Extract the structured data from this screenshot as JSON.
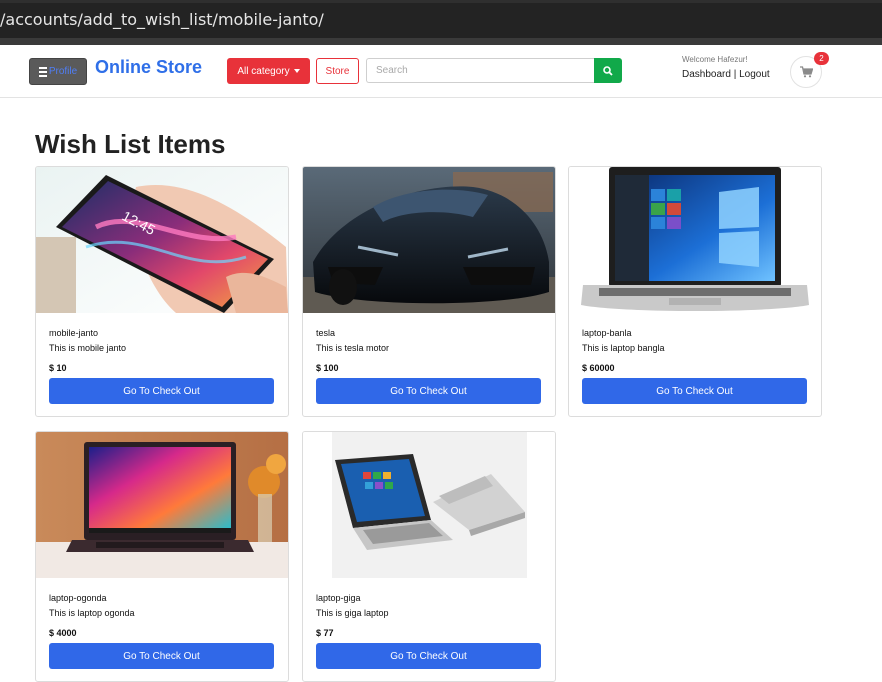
{
  "browser": {
    "url": "/accounts/add_to_wish_list/mobile-janto/"
  },
  "navbar": {
    "profile_label": "Profile",
    "brand": "Online Store",
    "category_label": "All category",
    "store_label": "Store",
    "search_placeholder": "Search",
    "welcome_text": "Welcome Hafezur!",
    "dashboard_label": "Dashboard",
    "separator": " | ",
    "logout_label": "Logout",
    "cart_count": "2"
  },
  "page": {
    "title": "Wish List Items"
  },
  "products": [
    {
      "name": "mobile-janto",
      "description": "This is mobile janto",
      "price": "$ 10",
      "button": "Go To Check Out",
      "image": "smartphone-photo"
    },
    {
      "name": "tesla",
      "description": "This is tesla motor",
      "price": "$ 100",
      "button": "Go To Check Out",
      "image": "sports-car-photo"
    },
    {
      "name": "laptop-banla",
      "description": "This is laptop bangla",
      "price": "$ 60000",
      "button": "Go To Check Out",
      "image": "laptop-photo"
    },
    {
      "name": "laptop-ogonda",
      "description": "This is laptop ogonda",
      "price": "$ 4000",
      "button": "Go To Check Out",
      "image": "laptop-photo"
    },
    {
      "name": "laptop-giga",
      "description": "This is giga laptop",
      "price": "$ 77",
      "button": "Go To Check Out",
      "image": "convertible-laptop-photo"
    }
  ],
  "colors": {
    "brand": "#2f6fe8",
    "danger": "#e8323a",
    "success": "#11a94a",
    "primary": "#3068e8"
  }
}
